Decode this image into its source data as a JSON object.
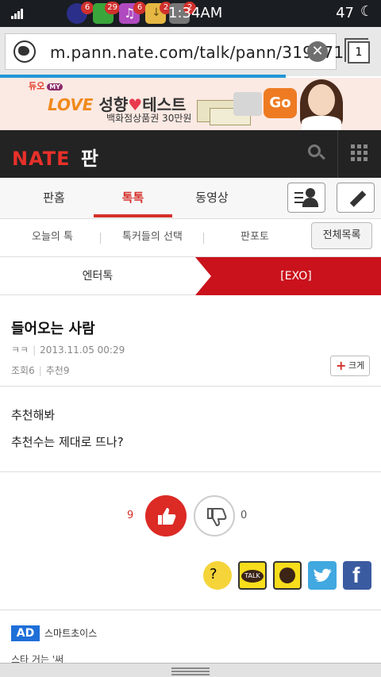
{
  "status_bar": {
    "time": "1:34AM",
    "battery": "47",
    "notifications": [
      {
        "icon": "messenger-icon",
        "count": "6"
      },
      {
        "icon": "nate-app-icon",
        "count": "29"
      },
      {
        "icon": "music-icon",
        "count": "6"
      },
      {
        "icon": "download-icon",
        "count": "2"
      },
      {
        "icon": "app-icon",
        "count": "2"
      }
    ]
  },
  "browser": {
    "url": "m.pann.nate.com/talk/pann/319871",
    "tab_count": "1"
  },
  "ad_banner": {
    "brand": "듀오",
    "brand_tag": "MY",
    "headline_love": "LOVE",
    "headline_rest": "성향",
    "headline_test": "테스트",
    "prize": "백화점상품권 30만원",
    "go_label": "Go"
  },
  "site_header": {
    "logo_nate": "NATE",
    "logo_pan": "판"
  },
  "main_tabs": [
    {
      "label": "판홈"
    },
    {
      "label": "톡톡"
    },
    {
      "label": "동영상"
    }
  ],
  "sub_tabs": [
    {
      "label": "오늘의 톡"
    },
    {
      "label": "톡커들의 선택"
    },
    {
      "label": "판포토"
    }
  ],
  "all_list_label": "전체목록",
  "category": {
    "left": "엔터톡",
    "right": "[EXO]"
  },
  "post": {
    "title": "들어오는 사람",
    "author": "ㅋㅋ",
    "date": "2013.11.05 00:29",
    "views": "조회6",
    "recommends": "추천9",
    "enlarge_label": "크게",
    "body_line1": "추천해봐",
    "body_line2": "추천수는 제대로 뜨나?"
  },
  "votes": {
    "up": "9",
    "down": "0"
  },
  "share_icons": [
    "emoji-icon",
    "kakaotalk-icon",
    "kakaostory-icon",
    "twitter-icon",
    "facebook-icon"
  ],
  "ad_section": {
    "label": "AD",
    "sponsor": "스마트초이스",
    "teaser": "스타 거는 '써"
  },
  "colors": {
    "accent": "#d5302a",
    "category_bg": "#c9121c",
    "header_bg": "#232323"
  }
}
